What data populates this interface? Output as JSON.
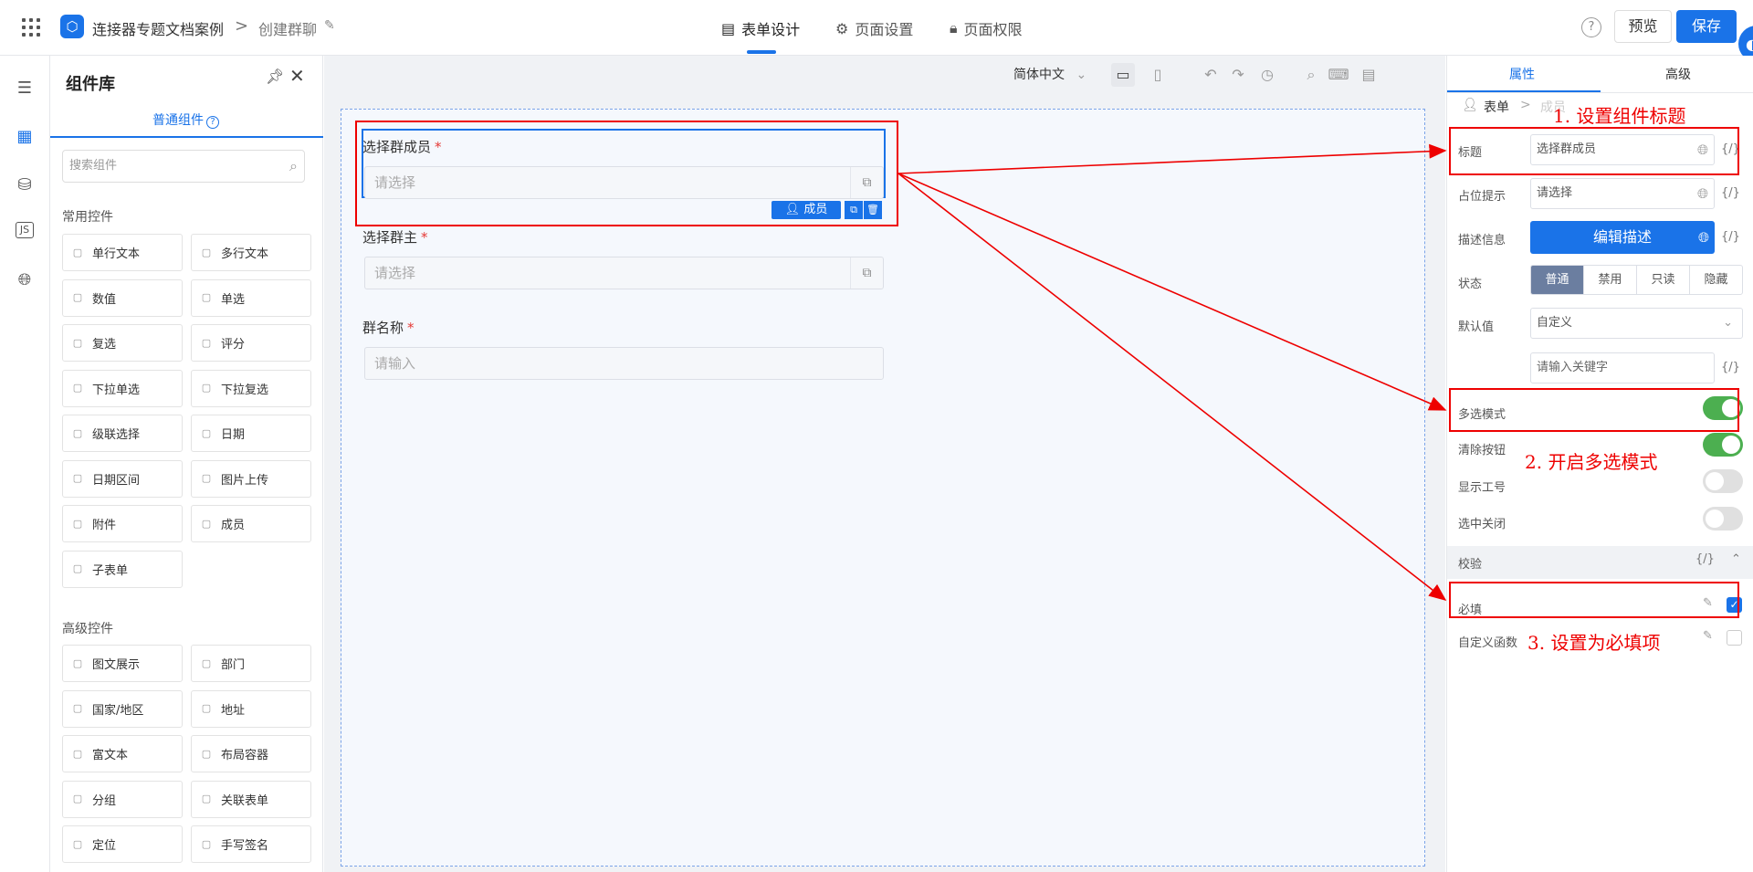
{
  "header": {
    "app_title": "连接器专题文档案例",
    "crumb_sep": ">",
    "page_name": "创建群聊",
    "tabs": [
      {
        "label": "表单设计",
        "icon": "document-icon"
      },
      {
        "label": "页面设置",
        "icon": "gear-icon"
      },
      {
        "label": "页面权限",
        "icon": "lock-icon"
      }
    ],
    "help": "?",
    "preview_label": "预览",
    "save_label": "保存"
  },
  "library": {
    "title": "组件库",
    "tab_label": "普通组件",
    "tab_help": "?",
    "search_placeholder": "搜索组件",
    "common_title": "常用控件",
    "common": [
      {
        "label": "单行文本",
        "icon": "single-line-icon"
      },
      {
        "label": "多行文本",
        "icon": "multi-line-icon"
      },
      {
        "label": "数值",
        "icon": "number-icon"
      },
      {
        "label": "单选",
        "icon": "radio-icon"
      },
      {
        "label": "复选",
        "icon": "checkbox-icon"
      },
      {
        "label": "评分",
        "icon": "star-icon"
      },
      {
        "label": "下拉单选",
        "icon": "dropdown-icon"
      },
      {
        "label": "下拉复选",
        "icon": "dropdown-multi-icon"
      },
      {
        "label": "级联选择",
        "icon": "cascade-icon"
      },
      {
        "label": "日期",
        "icon": "calendar-icon"
      },
      {
        "label": "日期区间",
        "icon": "date-range-icon"
      },
      {
        "label": "图片上传",
        "icon": "image-icon"
      },
      {
        "label": "附件",
        "icon": "paperclip-icon"
      },
      {
        "label": "成员",
        "icon": "user-icon"
      },
      {
        "label": "子表单",
        "icon": "subform-icon"
      }
    ],
    "advanced_title": "高级控件",
    "advanced": [
      {
        "label": "图文展示",
        "icon": "image-text-icon"
      },
      {
        "label": "部门",
        "icon": "department-icon"
      },
      {
        "label": "国家/地区",
        "icon": "globe-icon"
      },
      {
        "label": "地址",
        "icon": "address-icon"
      },
      {
        "label": "富文本",
        "icon": "richtext-icon"
      },
      {
        "label": "布局容器",
        "icon": "layout-icon"
      },
      {
        "label": "分组",
        "icon": "group-icon"
      },
      {
        "label": "关联表单",
        "icon": "related-form-icon"
      },
      {
        "label": "定位",
        "icon": "location-icon"
      },
      {
        "label": "手写签名",
        "icon": "pen-icon"
      }
    ]
  },
  "toolbar": {
    "language": "简体中文"
  },
  "form": {
    "fields": [
      {
        "label": "选择群成员",
        "required": "*",
        "placeholder": "请选择"
      },
      {
        "label": "选择群主",
        "required": "*",
        "placeholder": "请选择"
      },
      {
        "label": "群名称",
        "required": "*",
        "placeholder": "请输入"
      }
    ],
    "selected_tag": "成员"
  },
  "props": {
    "tab_attr": "属性",
    "tab_adv": "高级",
    "crumb_form": "表单",
    "crumb_sep": ">",
    "crumb_member": "成员",
    "curly": "{/}",
    "title_label": "标题",
    "title_value": "选择群成员",
    "placeholder_label": "占位提示",
    "placeholder_value": "请选择",
    "desc_label": "描述信息",
    "desc_button": "编辑描述",
    "state_label": "状态",
    "states": [
      "普通",
      "禁用",
      "只读",
      "隐藏"
    ],
    "default_label": "默认值",
    "default_value": "自定义",
    "keyword_placeholder": "请输入关键字",
    "multi_label": "多选模式",
    "clear_label": "清除按钮",
    "show_id_label": "显示工号",
    "close_label": "选中关闭",
    "validate_label": "校验",
    "required_label": "必填",
    "custom_fn_label": "自定义函数"
  },
  "annotations": {
    "a1": "1. 设置组件标题",
    "a2": "2. 开启多选模式",
    "a3": "3. 设置为必填项"
  },
  "colors": {
    "accent": "#1a73e8",
    "annotation": "#e00000",
    "toggle_on": "#4caf50"
  }
}
